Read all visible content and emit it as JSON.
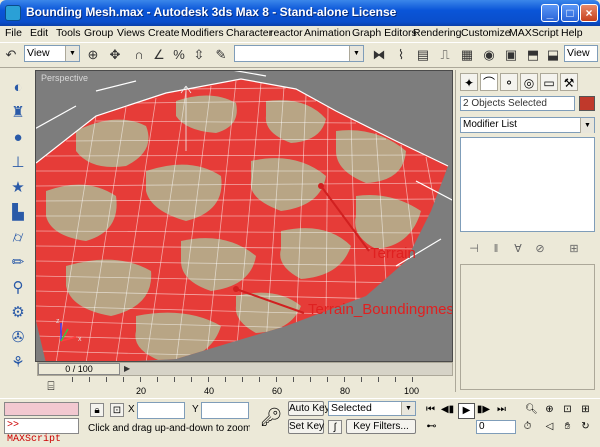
{
  "window": {
    "title": "Bounding Mesh.max - Autodesk 3ds Max 8 - Stand-alone License",
    "controls": {
      "minimize": "_",
      "maximize": "□",
      "close": "×"
    }
  },
  "menu": [
    "File",
    "Edit",
    "Tools",
    "Group",
    "Views",
    "Create",
    "Modifiers",
    "Character",
    "reactor",
    "Animation",
    "Graph Editors",
    "Rendering",
    "Customize",
    "MAXScript",
    "Help"
  ],
  "toolbar": {
    "ref_coord": "View",
    "named_selection": "",
    "right_view": "View"
  },
  "viewport": {
    "label": "Perspective",
    "annotations": [
      "Terrain",
      "Terrain_Boundingmesh"
    ],
    "colors": {
      "background": "#7d7d7d",
      "terrain": "#b8a585",
      "bounding_mesh": "#e63c38",
      "grid": "#ffffff"
    }
  },
  "command_panel": {
    "selection_text": "2 Objects Selected",
    "modifier_list": "Modifier List"
  },
  "time_slider": {
    "position": "0 / 100",
    "ticks": [
      "20",
      "40",
      "60",
      "80",
      "100"
    ]
  },
  "status": {
    "maxscript": ">> MAXScript",
    "x_label": "X",
    "y_label": "Y",
    "prompt": "Click and drag up-and-down to zoom in and out",
    "auto_key": "Auto Key",
    "set_key": "Set Key",
    "key_mode": "Selected",
    "key_filters": "Key Filters...",
    "frame": "0"
  }
}
